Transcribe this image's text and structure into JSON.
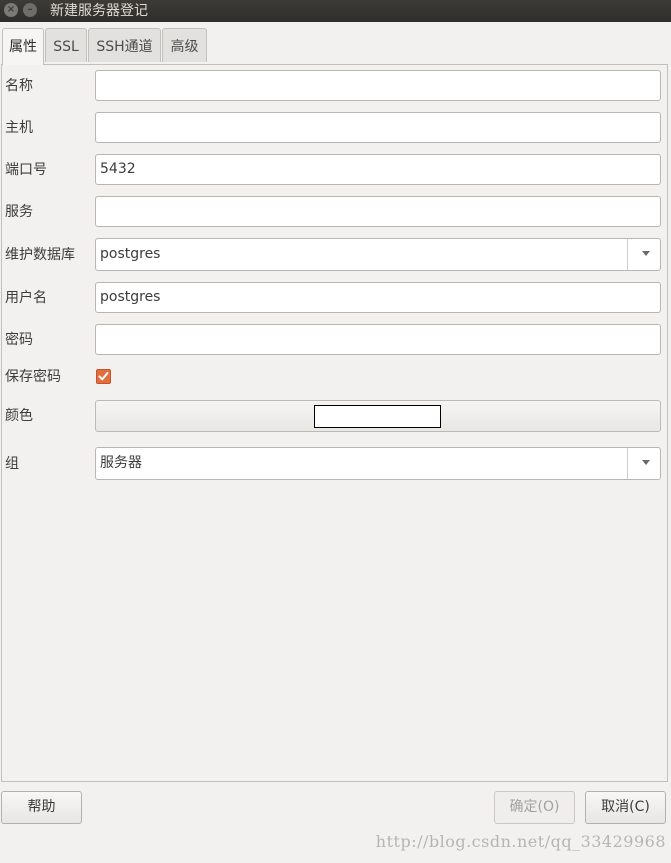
{
  "window": {
    "title": "新建服务器登记",
    "close_glyph": "×",
    "minimize_glyph": "–"
  },
  "tabs": [
    {
      "label": "属性",
      "active": true
    },
    {
      "label": "SSL",
      "active": false
    },
    {
      "label": "SSH通道",
      "active": false
    },
    {
      "label": "高级",
      "active": false
    }
  ],
  "form": {
    "name": {
      "label": "名称",
      "value": ""
    },
    "host": {
      "label": "主机",
      "value": ""
    },
    "port": {
      "label": "端口号",
      "value": "5432"
    },
    "service": {
      "label": "服务",
      "value": ""
    },
    "maintenance_db": {
      "label": "维护数据库",
      "value": "postgres"
    },
    "username": {
      "label": "用户名",
      "value": "postgres"
    },
    "password": {
      "label": "密码",
      "value": ""
    },
    "save_password": {
      "label": "保存密码",
      "checked": true
    },
    "color": {
      "label": "颜色",
      "value": "#ffffff"
    },
    "group": {
      "label": "组",
      "value": "服务器"
    }
  },
  "buttons": {
    "help": "帮助",
    "ok": "确定(O)",
    "cancel": "取消(C)"
  },
  "watermark": "http://blog.csdn.net/qq_33429968",
  "colors": {
    "checkbox_accent": "#e46d40",
    "titlebar": "#3c3b37"
  }
}
